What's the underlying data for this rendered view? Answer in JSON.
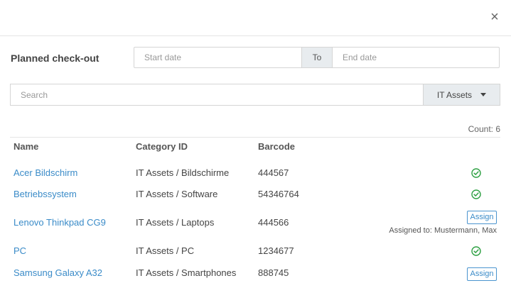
{
  "modal": {
    "close_symbol": "×"
  },
  "filters": {
    "planned_checkout_label": "Planned check-out",
    "start_placeholder": "Start date",
    "to_label": "To",
    "end_placeholder": "End date",
    "search_placeholder": "Search",
    "category_selected": "IT Assets"
  },
  "table": {
    "count_text": "Count: 6",
    "headers": {
      "name": "Name",
      "category": "Category ID",
      "barcode": "Barcode"
    },
    "rows": [
      {
        "name": "Acer Bildschirm",
        "category": "IT Assets / Bildschirme",
        "barcode": "444567",
        "status": "available"
      },
      {
        "name": "Betriebssystem",
        "category": "IT Assets / Software",
        "barcode": "54346764",
        "status": "available"
      },
      {
        "name": "Lenovo Thinkpad CG9",
        "category": "IT Assets / Laptops",
        "barcode": "444566",
        "status": "assigned",
        "assign_label": "Assign",
        "assigned_text": "Assigned to: Mustermann, Max"
      },
      {
        "name": "PC",
        "category": "IT Assets / PC",
        "barcode": "1234677",
        "status": "available"
      },
      {
        "name": "Samsung Galaxy A32",
        "category": "IT Assets / Smartphones",
        "barcode": "888745",
        "status": "unassigned",
        "assign_label": "Assign"
      }
    ]
  },
  "colors": {
    "link": "#3a8bc8",
    "available": "#2ea043",
    "addon_bg": "#e8ecef",
    "border": "#d5d5d5"
  },
  "icons": {
    "close": "close-icon",
    "available": "check-circle-icon",
    "dropdown": "caret-down-icon"
  }
}
